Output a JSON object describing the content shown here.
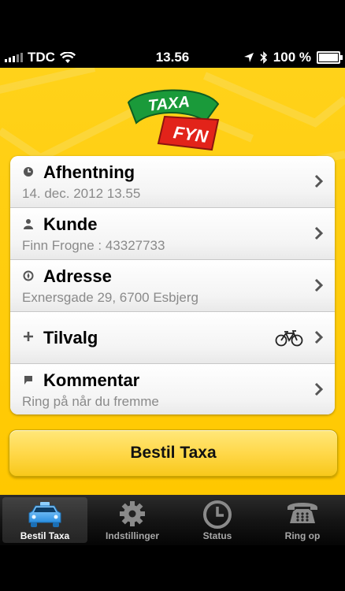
{
  "status_bar": {
    "carrier": "TDC",
    "time": "13.56",
    "battery": "100 %",
    "battery_level": 1.0
  },
  "rows": [
    {
      "title": "Afhentning",
      "subtitle": "14. dec. 2012 13.55",
      "icon": "clock-icon"
    },
    {
      "title": "Kunde",
      "subtitle": "Finn Frogne : 43327733",
      "icon": "person-icon"
    },
    {
      "title": "Adresse",
      "subtitle": "Exnersgade 29, 6700 Esbjerg",
      "icon": "compass-icon"
    },
    {
      "title": "Tilvalg",
      "subtitle": "",
      "icon": "plus-icon"
    },
    {
      "title": "Kommentar",
      "subtitle": "Ring på når du fremme",
      "icon": "comment-icon"
    }
  ],
  "order_button": {
    "label": "Bestil Taxa"
  },
  "tabs": [
    {
      "label": "Bestil Taxa",
      "icon": "taxi-car-icon",
      "active": true
    },
    {
      "label": "Indstillinger",
      "icon": "gear-icon",
      "active": false
    },
    {
      "label": "Status",
      "icon": "clock-icon",
      "active": false
    },
    {
      "label": "Ring op",
      "icon": "telephone-icon",
      "active": false
    }
  ],
  "colors": {
    "brand_yellow": "#ffd21a",
    "logo_green": "#1a9a3a",
    "logo_red": "#e2231a"
  }
}
